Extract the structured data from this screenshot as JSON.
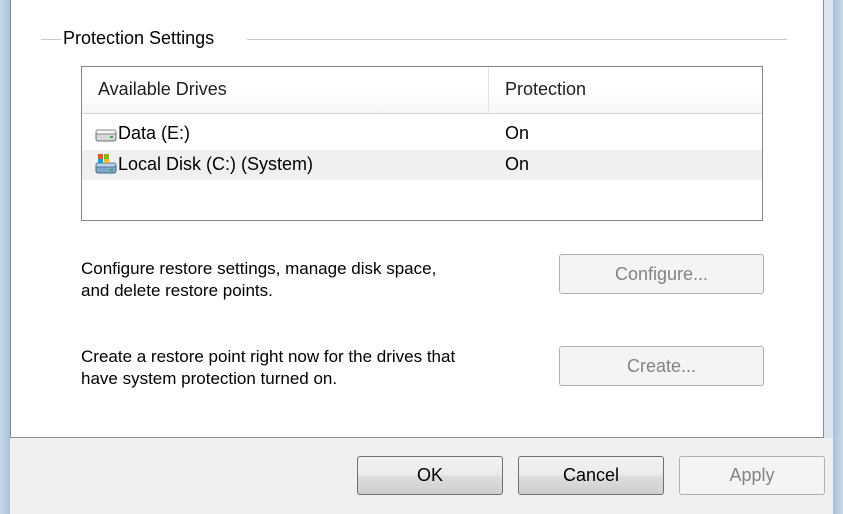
{
  "group": {
    "title": "Protection Settings"
  },
  "drives_table": {
    "columns": [
      "Available Drives",
      "Protection"
    ],
    "rows": [
      {
        "name": "Data (E:)",
        "protection": "On",
        "icon": "drive-icon"
      },
      {
        "name": "Local Disk (C:) (System)",
        "protection": "On",
        "icon": "system-drive-icon"
      }
    ]
  },
  "configure": {
    "description_line1": "Configure restore settings, manage disk space,",
    "description_line2": "and delete restore points.",
    "button_label": "Configure..."
  },
  "create": {
    "description_line1": "Create a restore point right now for the drives that",
    "description_line2": "have system protection turned on.",
    "button_label": "Create..."
  },
  "dialog_buttons": {
    "ok_label": "OK",
    "cancel_label": "Cancel",
    "apply_label": "Apply"
  }
}
